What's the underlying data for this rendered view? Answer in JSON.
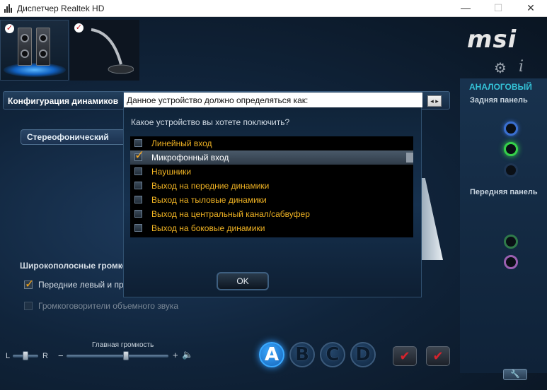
{
  "window": {
    "title": "Диспетчер Realtek HD",
    "minimize": "—",
    "maximize": "☐",
    "close": "✕"
  },
  "brand": {
    "logo": "msi",
    "gear_icon": "⚙",
    "info_icon": "i",
    "analog": "АНАЛОГОВЫЙ",
    "back_panel": "Задняя панель",
    "front_panel": "Передняя панель"
  },
  "config": {
    "title": "Конфигурация динамиков",
    "speaker_mode": "Стереофонический"
  },
  "wideband": {
    "title": "Широкополосные громкоговорители",
    "front_lr": "Передние левый и правый",
    "surround": "Громкоговорители объемного звука"
  },
  "bottom": {
    "l": "L",
    "r": "R",
    "master_volume": "Главная громкость",
    "minus": "−",
    "plus": "+",
    "speaker_glyph": "🔈",
    "profiles": [
      "A",
      "B",
      "C",
      "D"
    ],
    "check_glyph": "✔",
    "wrench_glyph": "🔧"
  },
  "dialog": {
    "title": "Данное устройство должно определяться как:",
    "question": "Какое устройство вы хотете поключить?",
    "options": [
      {
        "label": "Линейный вход",
        "checked": false
      },
      {
        "label": "Микрофонный вход",
        "checked": true
      },
      {
        "label": "Наушники",
        "checked": false
      },
      {
        "label": "Выход на передние динамики",
        "checked": false
      },
      {
        "label": "Выход на тыловые динамики",
        "checked": false
      },
      {
        "label": "Выход на центральный канал/сабвуфер",
        "checked": false
      },
      {
        "label": "Выход на боковые динамики",
        "checked": false
      }
    ],
    "ok": "OK",
    "scroll_arrows": "◂ ▸"
  },
  "colors": {
    "accent_cyan": "#34c3d8",
    "option_text": "#f0b323",
    "active_profile": "#38a7ff"
  },
  "master_volume_level": 0.58,
  "balance_level": 0.5
}
